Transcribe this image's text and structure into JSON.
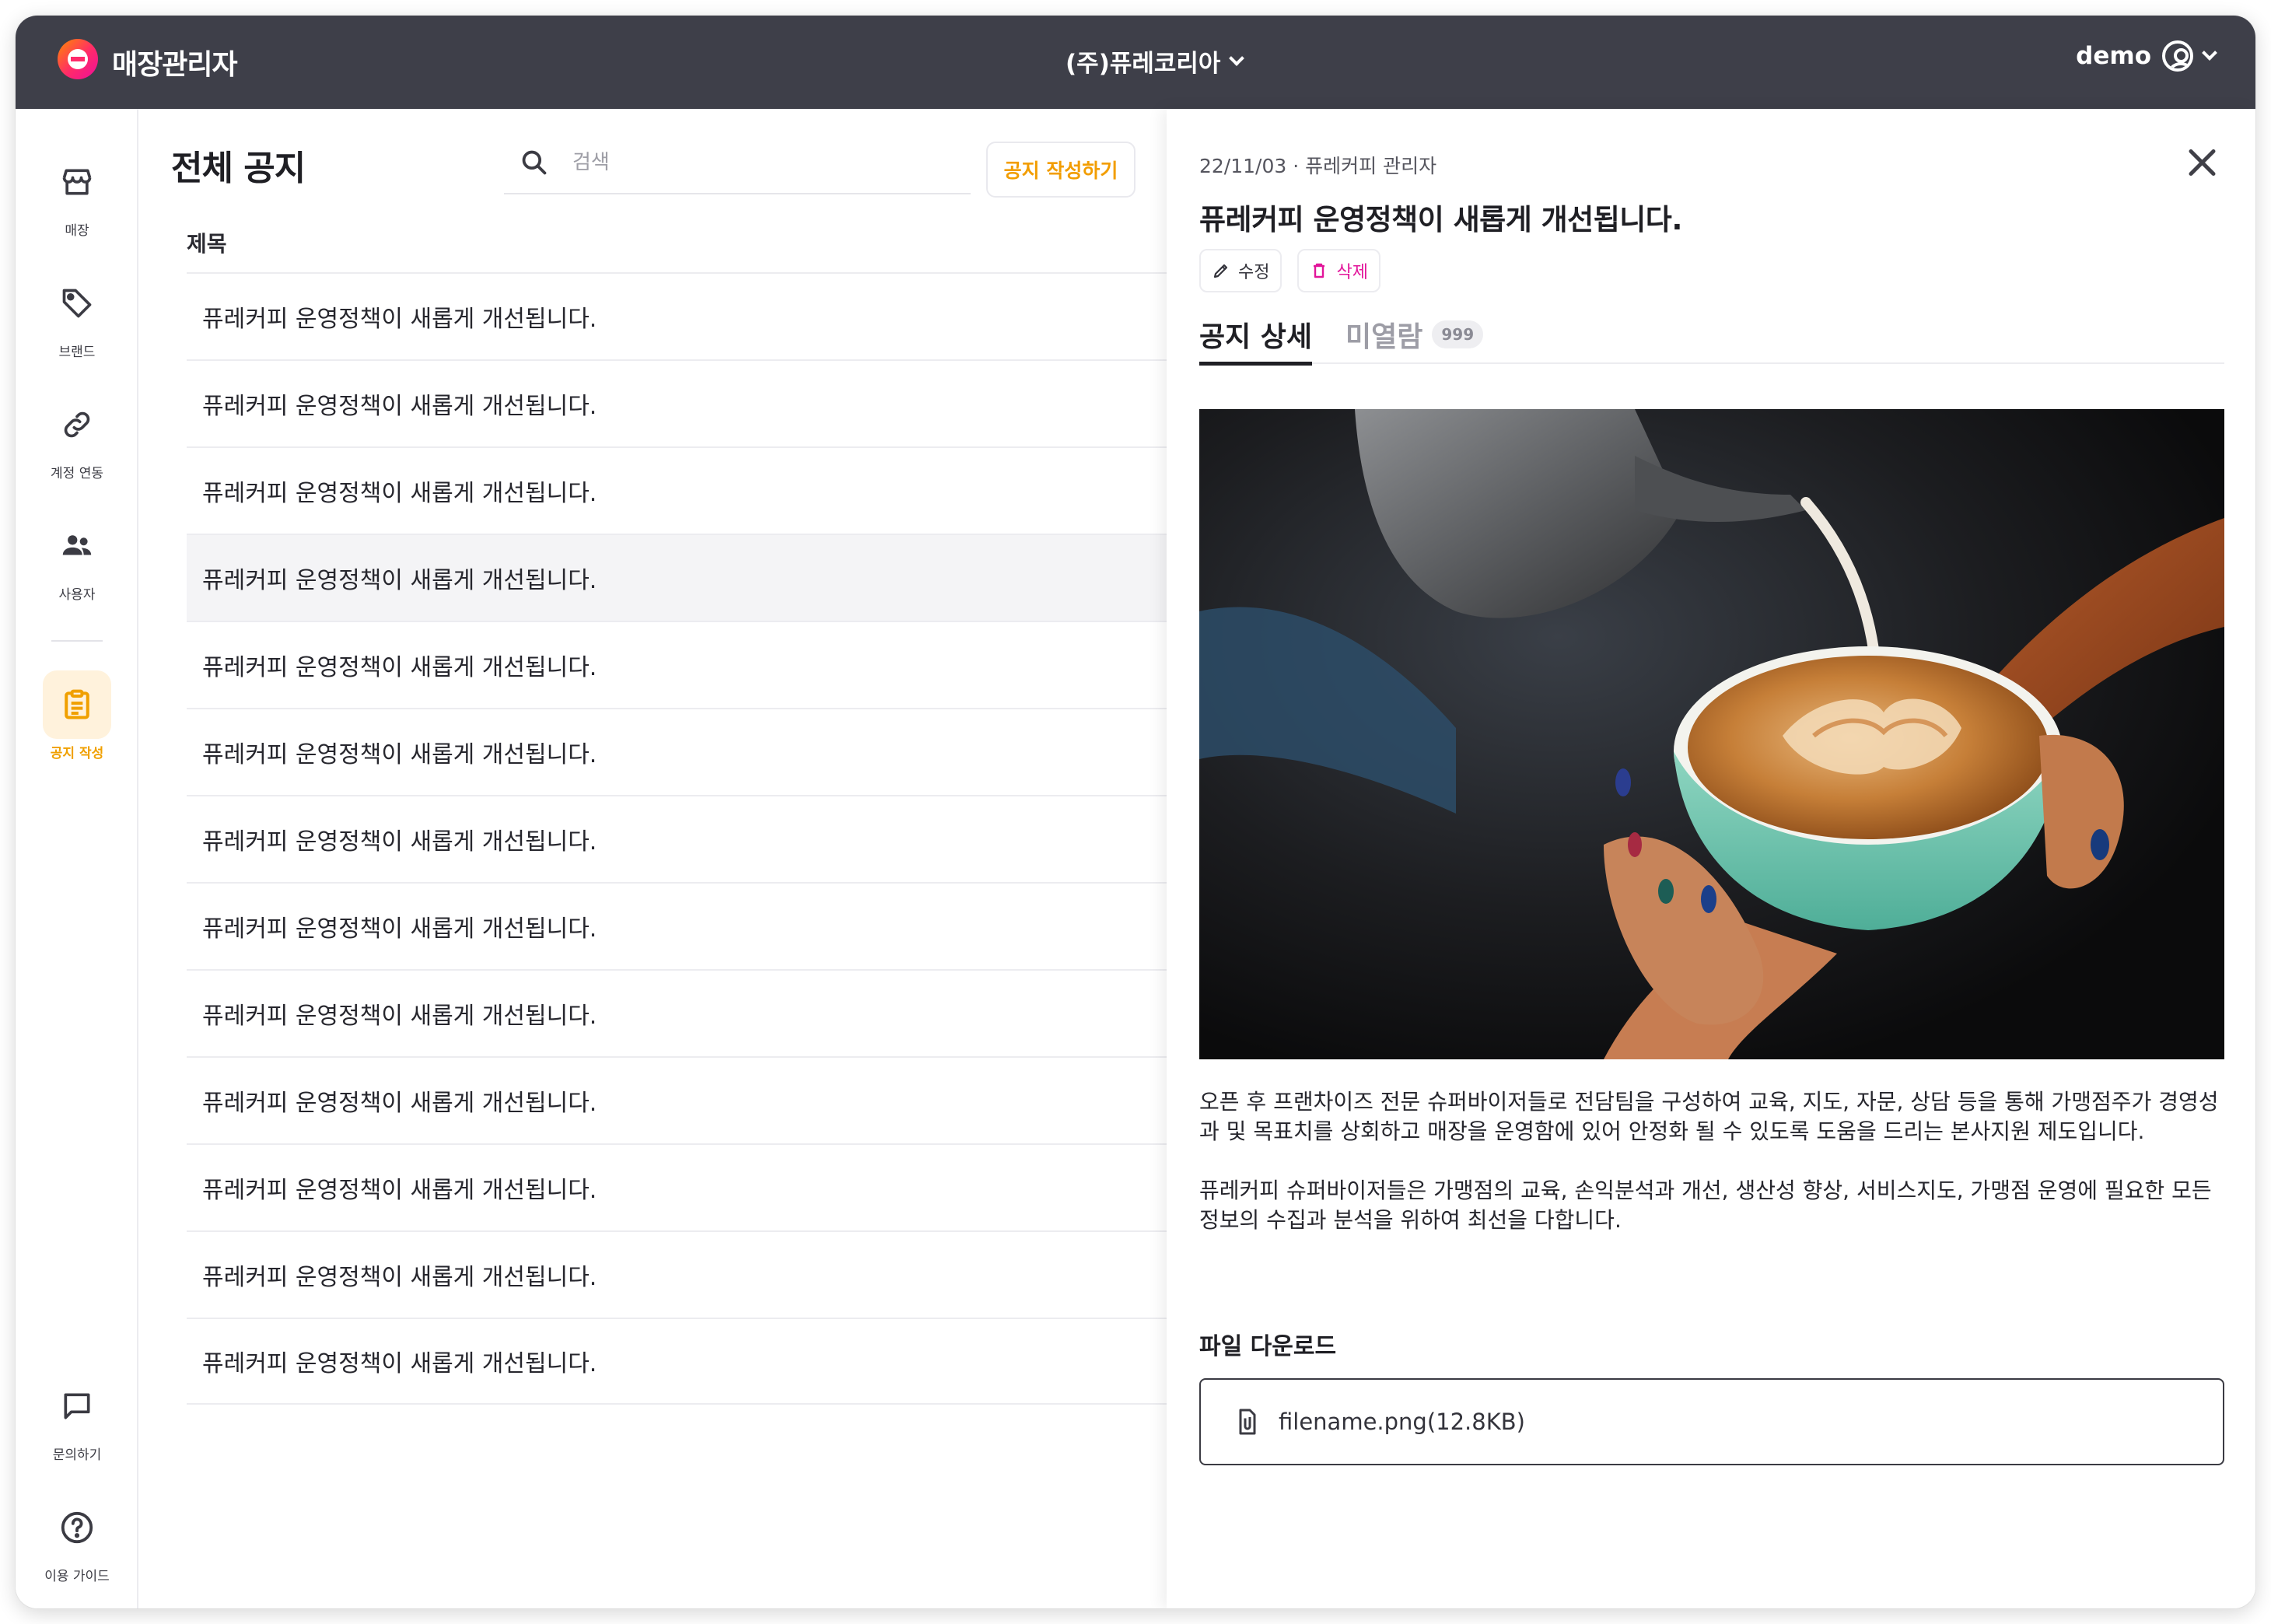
{
  "header": {
    "app_title": "매장관리자",
    "company": "(주)퓨레코리아",
    "user": "demo"
  },
  "sidebar": {
    "items": [
      {
        "label": "매장",
        "icon": "store-icon"
      },
      {
        "label": "브랜드",
        "icon": "tag-icon"
      },
      {
        "label": "계정 연동",
        "icon": "link-icon"
      },
      {
        "label": "사용자",
        "icon": "users-icon"
      },
      {
        "label": "공지 작성",
        "icon": "clipboard-icon",
        "active": true
      }
    ],
    "bottom_items": [
      {
        "label": "문의하기",
        "icon": "chat-icon"
      },
      {
        "label": "이용 가이드",
        "icon": "help-icon"
      }
    ]
  },
  "list": {
    "title": "전체 공지",
    "search_placeholder": "검색",
    "write_button": "공지 작성하기",
    "column_header": "제목",
    "rows": [
      "퓨레커피 운영정책이 새롭게 개선됩니다.",
      "퓨레커피 운영정책이 새롭게 개선됩니다.",
      "퓨레커피 운영정책이 새롭게 개선됩니다.",
      "퓨레커피 운영정책이 새롭게 개선됩니다.",
      "퓨레커피 운영정책이 새롭게 개선됩니다.",
      "퓨레커피 운영정책이 새롭게 개선됩니다.",
      "퓨레커피 운영정책이 새롭게 개선됩니다.",
      "퓨레커피 운영정책이 새롭게 개선됩니다.",
      "퓨레커피 운영정책이 새롭게 개선됩니다.",
      "퓨레커피 운영정책이 새롭게 개선됩니다.",
      "퓨레커피 운영정책이 새롭게 개선됩니다.",
      "퓨레커피 운영정책이 새롭게 개선됩니다.",
      "퓨레커피 운영정책이 새롭게 개선됩니다."
    ],
    "highlighted_row": 3
  },
  "detail": {
    "meta": "22/11/03 · 퓨레커피 관리자",
    "title": "퓨레커피 운영정책이 새롭게 개선됩니다.",
    "edit_label": "수정",
    "delete_label": "삭제",
    "tab_detail": "공지 상세",
    "tab_unread": "미열람",
    "unread_count": "999",
    "paragraph1": "오픈 후 프랜차이즈 전문 슈퍼바이저들로 전담팀을 구성하여 교육, 지도, 자문, 상담 등을 통해 가맹점주가 경영성과 및 목표치를 상회하고 매장을 운영함에 있어 안정화 될 수 있도록 도움을 드리는 본사지원 제도입니다.",
    "paragraph2": "퓨레커피 슈퍼바이저들은 가맹점의 교육, 손익분석과 개선, 생산성 향상, 서비스지도, 가맹점 운영에 필요한 모든 정보의 수집과 분석을 위하여 최선을 다합니다.",
    "file_section_title": "파일 다운로드",
    "file_name": "filename.png(12.8KB)"
  },
  "colors": {
    "topbar": "#3e3f49",
    "accent": "#f29d00",
    "danger": "#e2159a"
  }
}
